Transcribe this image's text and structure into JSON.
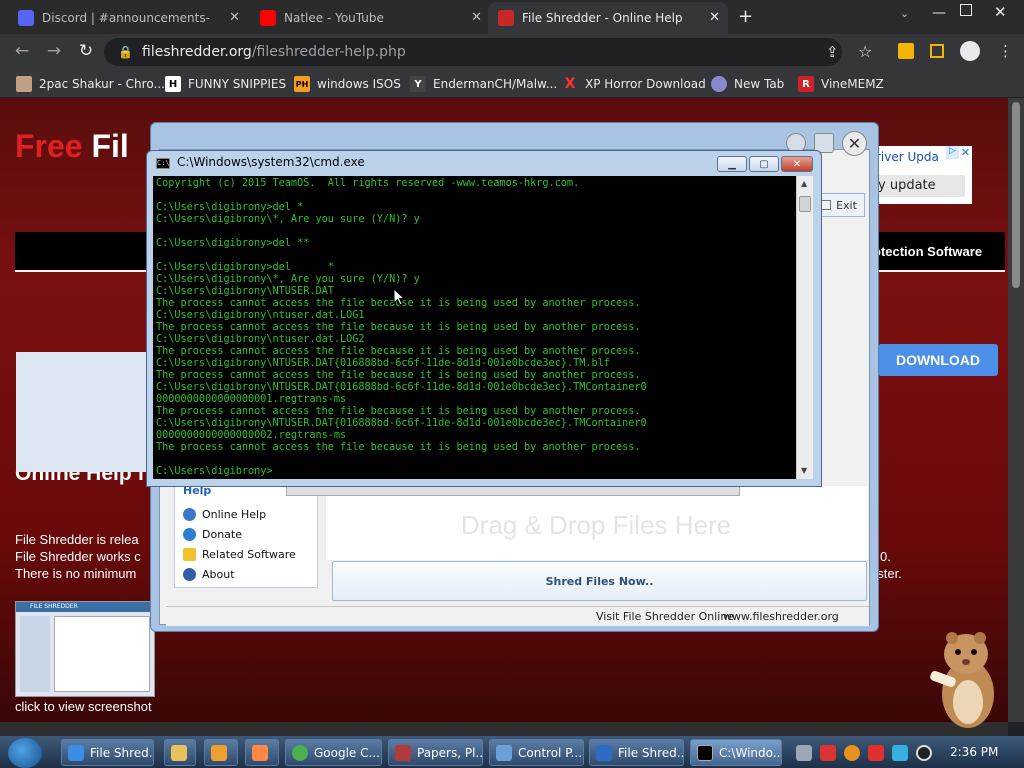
{
  "browser": {
    "tabs": [
      {
        "title": "Discord | #announcements-",
        "active": false
      },
      {
        "title": "Natlee - YouTube",
        "active": false
      },
      {
        "title": "File Shredder - Online Help",
        "active": true
      }
    ],
    "url_host": "fileshredder.org",
    "url_path": "/fileshredder-help.php",
    "bookmarks": [
      {
        "label": "2pac Shakur - Chro...",
        "icon": "bookmark-icon"
      },
      {
        "label": "FUNNY SNIPPIES",
        "icon": "H"
      },
      {
        "label": "windows ISOS",
        "icon": "PH"
      },
      {
        "label": "EndermanCH/Malw...",
        "icon": "Y"
      },
      {
        "label": "XP Horror Download",
        "icon": "X"
      },
      {
        "label": "New Tab",
        "icon": "globe-icon"
      },
      {
        "label": "VineMEMZ",
        "icon": "R"
      }
    ]
  },
  "site": {
    "title_word1": "Free",
    "title_word2": "Fil",
    "menu_right": "otection Software",
    "ad_line1": "river Upda",
    "ad_line2": "y update",
    "download_label": "DOWNLOAD",
    "heading": "Online Help f",
    "para_lines": [
      "File Shredder is relea",
      "File Shredder works c",
      "There is no minimum"
    ],
    "para_right": [
      "0.",
      "aster."
    ],
    "thumb_caption": "click to view screenshot",
    "thumb_title": "FILE SHREDDER"
  },
  "fileshredder": {
    "help_heading": "Help",
    "menu": [
      {
        "label": "Online Help",
        "icon": "help-icon"
      },
      {
        "label": "Donate",
        "icon": "donate-icon"
      },
      {
        "label": "Related Software",
        "icon": "star-icon"
      },
      {
        "label": "About",
        "icon": "info-icon"
      }
    ],
    "drop_text": "Drag & Drop Files Here",
    "shred_label": "Shred Files Now..",
    "exit_label": "Exit",
    "status_visit": "Visit File Shredder Online",
    "status_url": "www.fileshredder.org"
  },
  "cmd": {
    "title": "C:\\Windows\\system32\\cmd.exe",
    "lines": [
      "Copyright (c) 2015 TeamOS.  All rights reserved -www.teamos-hkrg.com.",
      "",
      "C:\\Users\\digibrony>del *",
      "C:\\Users\\digibrony\\*, Are you sure (Y/N)? y",
      "",
      "C:\\Users\\digibrony>del **",
      "",
      "C:\\Users\\digibrony>del      *",
      "C:\\Users\\digibrony\\*, Are you sure (Y/N)? y",
      "C:\\Users\\digibrony\\NTUSER.DAT",
      "The process cannot access the file because it is being used by another process.",
      "C:\\Users\\digibrony\\ntuser.dat.LOG1",
      "The process cannot access the file because it is being used by another process.",
      "C:\\Users\\digibrony\\ntuser.dat.LOG2",
      "The process cannot access the file because it is being used by another process.",
      "C:\\Users\\digibrony\\NTUSER.DAT{016888bd-6c6f-11de-8d1d-001e0bcde3ec}.TM.blf",
      "The process cannot access the file because it is being used by another process.",
      "C:\\Users\\digibrony\\NTUSER.DAT{016888bd-6c6f-11de-8d1d-001e0bcde3ec}.TMContainer0",
      "0000000000000000001.regtrans-ms",
      "The process cannot access the file because it is being used by another process.",
      "C:\\Users\\digibrony\\NTUSER.DAT{016888bd-6c6f-11de-8d1d-001e0bcde3ec}.TMContainer0",
      "0000000000000000002.regtrans-ms",
      "The process cannot access the file because it is being used by another process.",
      "",
      "C:\\Users\\digibrony>"
    ]
  },
  "taskbar": {
    "items": [
      {
        "label": "File Shred...",
        "icon": "ie-icon"
      },
      {
        "label": "",
        "icon": "folder-icon"
      },
      {
        "label": "",
        "icon": "media-player-icon"
      },
      {
        "label": "",
        "icon": "app-icon"
      },
      {
        "label": "Google C...",
        "icon": "chrome-icon"
      },
      {
        "label": "Papers, Pl...",
        "icon": "papers-please-icon"
      },
      {
        "label": "Control P...",
        "icon": "control-panel-icon"
      },
      {
        "label": "File Shred...",
        "icon": "file-shredder-icon"
      },
      {
        "label": "C:\\Windo...",
        "icon": "cmd-icon"
      }
    ],
    "clock": "2:36 PM"
  },
  "colors": {
    "cmd_text": "#2fbf2f",
    "site_red": "#e02020",
    "download_blue": "#4b8fe8"
  }
}
